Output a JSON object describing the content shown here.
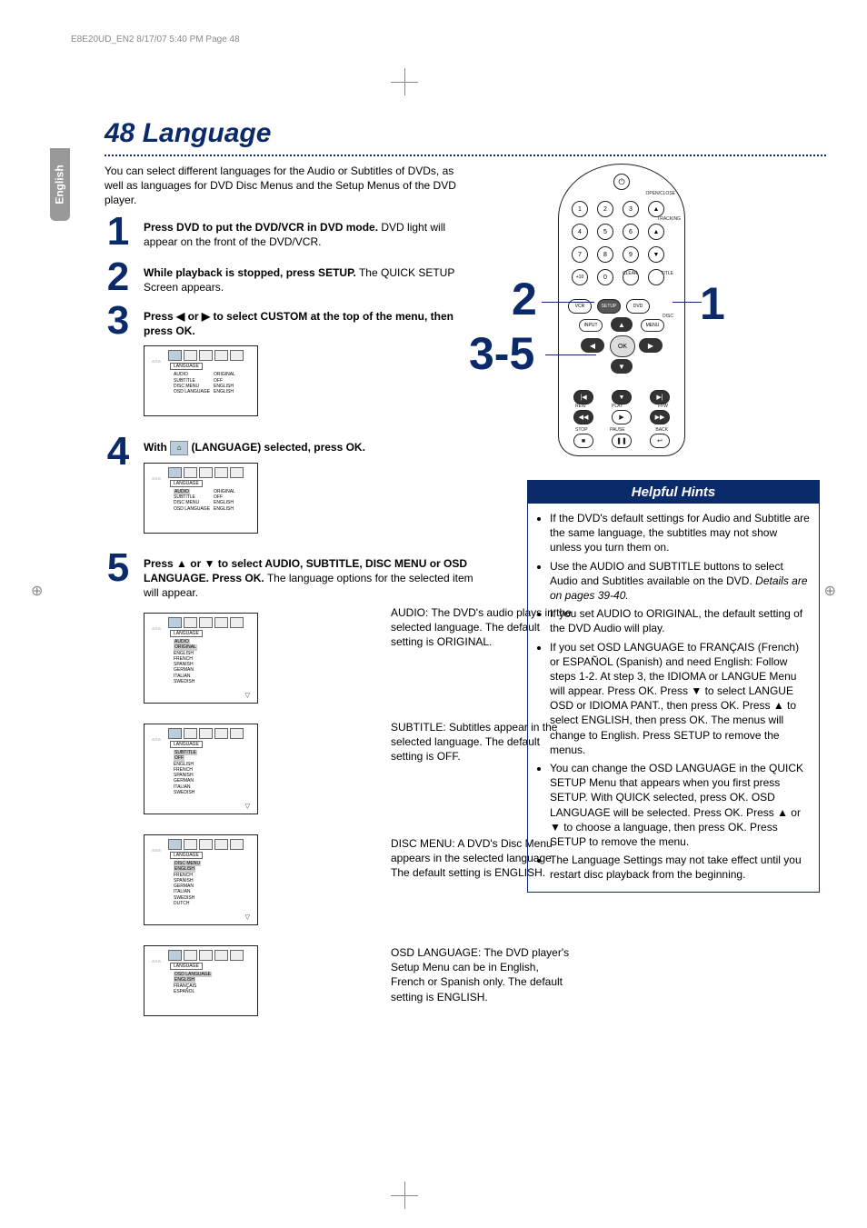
{
  "header": "E8E20UD_EN2  8/17/07  5:40 PM  Page 48",
  "side_tab": "English",
  "title": "48  Language",
  "intro": "You can select different languages for the Audio or Subtitles of DVDs, as well as languages for DVD Disc Menus and the Setup Menus of the DVD player.",
  "steps": {
    "s1": {
      "num": "1",
      "bold": "Press DVD to put the DVD/VCR in DVD mode.",
      "rest": " DVD light will appear on the front of the DVD/VCR."
    },
    "s2": {
      "num": "2",
      "bold": "While playback is stopped, press SETUP.",
      "rest": " The QUICK SETUP Screen appears."
    },
    "s3": {
      "num": "3",
      "bold": "Press ◀ or ▶ to select CUSTOM at the top of the menu, then press OK.",
      "rest": ""
    },
    "s4": {
      "num": "4",
      "pre": "With ",
      "icon": "⌂",
      "post": " (LANGUAGE) selected, press OK."
    },
    "s5": {
      "num": "5",
      "bold": "Press ▲ or ▼ to select AUDIO, SUBTITLE, DISC MENU or OSD LANGUAGE. Press OK.",
      "rest": " The language options for the selected item will appear."
    }
  },
  "osd_shared": {
    "tab_label": "LANGUAGE",
    "left_deco": "⊙⊙⊙"
  },
  "osd3": {
    "rows": [
      {
        "k": "AUDIO",
        "v": "ORIGINAL"
      },
      {
        "k": "SUBTITLE",
        "v": "OFF"
      },
      {
        "k": "DISC MENU",
        "v": "ENGLISH"
      },
      {
        "k": "OSD LANGUAGE",
        "v": "ENGLISH"
      }
    ]
  },
  "osd4": {
    "rows": [
      {
        "k": "AUDIO",
        "v": "ORIGINAL"
      },
      {
        "k": "SUBTITLE",
        "v": "OFF"
      },
      {
        "k": "DISC MENU",
        "v": "ENGLISH"
      },
      {
        "k": "OSD LANGUAGE",
        "v": "ENGLISH"
      }
    ]
  },
  "osdA": {
    "header": "AUDIO",
    "rows": [
      "ORIGINAL",
      "ENGLISH",
      "FRENCH",
      "SPANISH",
      "GERMAN",
      "ITALIAN",
      "SWEDISH"
    ]
  },
  "osdB": {
    "header": "SUBTITLE",
    "rows": [
      "OFF",
      "ENGLISH",
      "FRENCH",
      "SPANISH",
      "GERMAN",
      "ITALIAN",
      "SWEDISH"
    ]
  },
  "osdC": {
    "header": "DISC MENU",
    "rows": [
      "ENGLISH",
      "FRENCH",
      "SPANISH",
      "GERMAN",
      "ITALIAN",
      "SWEDISH",
      "DUTCH"
    ]
  },
  "osdD": {
    "header": "OSD LANGUAGE",
    "rows": [
      "ENGLISH",
      "FRANÇAIS",
      "ESPAÑOL"
    ]
  },
  "desc": {
    "audio": "AUDIO: The DVD's audio plays in the selected language. The default setting is ORIGINAL.",
    "subtitle": "SUBTITLE: Subtitles appear in the selected language. The default setting is OFF.",
    "discmenu": "DISC MENU: A DVD's Disc Menu appears in the selected language. The default setting is ENGLISH.",
    "osdlang": "OSD LANGUAGE: The DVD player's Setup Menu can be in English, French or Spanish only. The default setting is ENGLISH."
  },
  "remote": {
    "power": "⏻",
    "labels": {
      "openclose": "OPEN/CLOSE",
      "tracking": "TRACKING",
      "clear": "CLEAR",
      "title": "TITLE",
      "disc": "DISC",
      "input": "INPUT",
      "menu": "MENU",
      "rew": "REW",
      "play": "PLAY",
      "ffw": "FFW",
      "stop": "STOP",
      "pause": "PAUSE",
      "back": "BACK"
    },
    "numpad": [
      "1",
      "2",
      "3",
      "▲",
      "4",
      "5",
      "6",
      "▲",
      "7",
      "8",
      "9",
      "▼",
      "+10",
      "0",
      "",
      ""
    ],
    "vcr": "VCR",
    "setup": "SETUP",
    "dvd": "DVD",
    "ok": "OK",
    "dirs": {
      "up": "▲",
      "down": "▼",
      "left": "◀",
      "right": "▶"
    },
    "t1": [
      "|◀",
      "▼",
      "▶|"
    ],
    "t2": [
      "◀◀",
      "▶",
      "▶▶"
    ],
    "t3": [
      "■",
      "❚❚",
      "↩"
    ]
  },
  "callouts": {
    "c1": "1",
    "c2": "2",
    "c35": "3-5"
  },
  "hints": {
    "title": "Helpful Hints",
    "items": [
      "If the DVD's default settings for Audio and Subtitle are the same language, the subtitles may not show unless you turn them on.",
      "Use the AUDIO and SUBTITLE buttons to select Audio and Subtitles available on the DVD. ",
      "If you set AUDIO to ORIGINAL, the default setting of the DVD Audio will play.",
      "If you set OSD LANGUAGE to FRANÇAIS (French) or ESPAÑOL (Spanish) and need English: Follow steps 1-2. At step 3, the IDIOMA or LANGUE Menu will appear. Press OK. Press ▼ to select LANGUE OSD or IDIOMA PANT., then press OK. Press ▲ to select ENGLISH, then press OK. The menus will change to English. Press SETUP to remove the menus.",
      "You can change the OSD LANGUAGE in the QUICK SETUP Menu that appears when you first press SETUP. With QUICK selected, press OK. OSD LANGUAGE will be selected. Press OK. Press ▲ or ▼ to choose a language, then press OK. Press SETUP to remove the menu.",
      "The Language Settings may not take effect until you restart disc playback from the beginning."
    ],
    "italic_note": "Details are on pages 39-40."
  }
}
